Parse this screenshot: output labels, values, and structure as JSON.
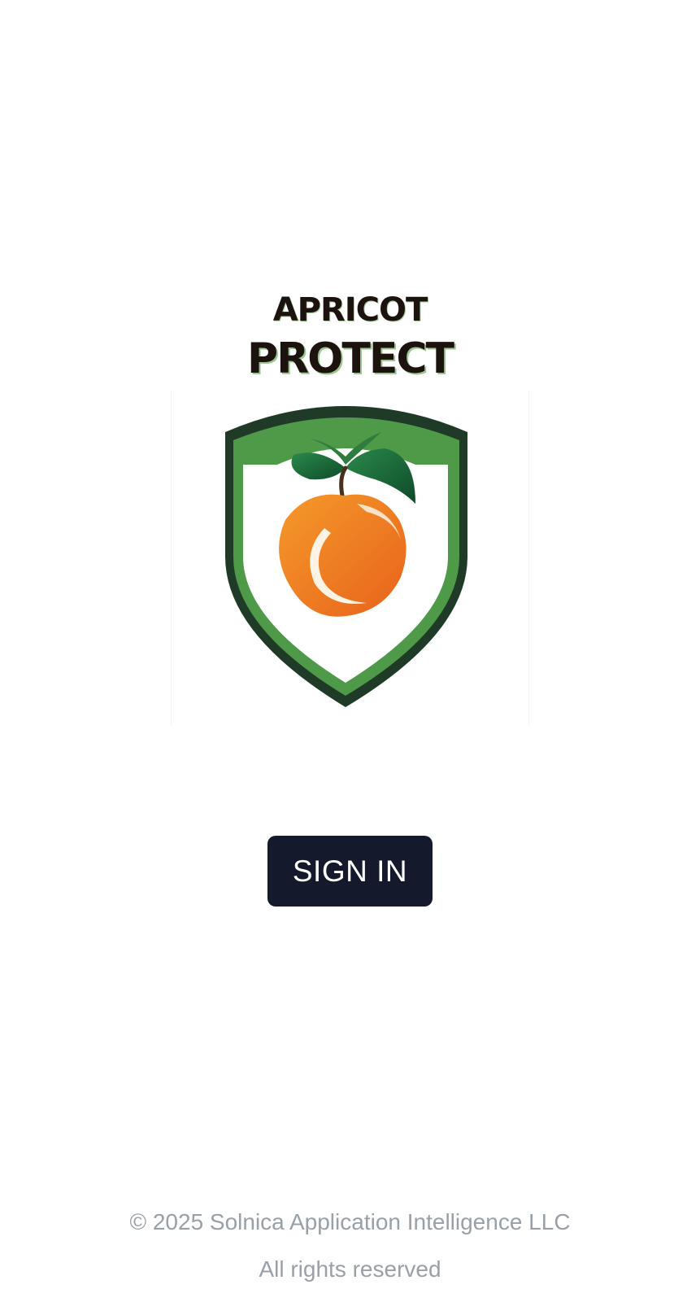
{
  "brand": {
    "line1": "APRICOT",
    "line2": "PROTECT",
    "colors": {
      "text": "#1c130e",
      "shield_dark": "#1f3a26",
      "shield_green": "#4f9a48",
      "apricot": "#ef7a1f",
      "leaf": "#1e6a3a"
    },
    "emblem_icon": "apricot-shield-logo"
  },
  "actions": {
    "sign_in_label": "SIGN IN",
    "button_color": "#141a2b"
  },
  "footer": {
    "copyright": "© 2025 Solnica Application Intelligence LLC",
    "rights": "All rights reserved"
  }
}
